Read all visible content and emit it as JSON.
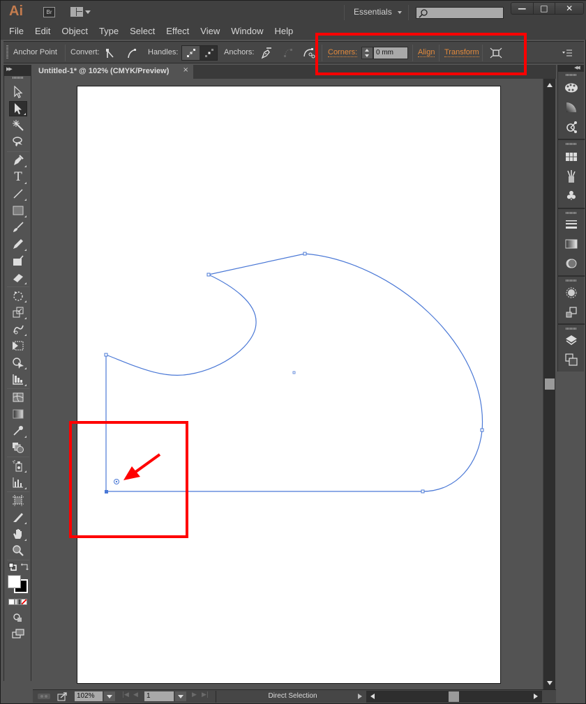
{
  "app": {
    "logo": "Ai",
    "bridge_button": "Br",
    "workspace": "Essentials",
    "search_placeholder": "",
    "window_controls": {
      "minimize": "—",
      "maximize": "□",
      "close": "✕"
    }
  },
  "menu": [
    "File",
    "Edit",
    "Object",
    "Type",
    "Select",
    "Effect",
    "View",
    "Window",
    "Help"
  ],
  "control_bar": {
    "context_label": "Anchor Point",
    "convert_label": "Convert:",
    "handles_label": "Handles:",
    "anchors_label": "Anchors:",
    "corners_label": "Corners:",
    "corners_value": "0 mm",
    "align_link": "Align",
    "transform_link": "Transform",
    "icons": {
      "convert": [
        "convert-to-corner-icon",
        "convert-to-smooth-icon"
      ],
      "handles": [
        "show-handles-icon",
        "hide-handles-icon"
      ],
      "anchors": [
        "remove-anchor-icon",
        "connect-endpoints-icon",
        "cut-path-icon"
      ],
      "isolate": "isolate-object-icon",
      "panel_menu": "panel-menu-icon"
    }
  },
  "document": {
    "tab_title": "Untitled-1* @ 102% (CMYK/Preview)",
    "tab_close": "×"
  },
  "tools": [
    "selection-tool",
    "direct-selection-tool",
    "magic-wand-tool",
    "lasso-tool",
    "pen-tool",
    "type-tool",
    "line-segment-tool",
    "rectangle-tool",
    "paintbrush-tool",
    "pencil-tool",
    "blob-brush-tool",
    "eraser-tool",
    "rotate-tool",
    "scale-tool",
    "warp-tool",
    "free-transform-tool",
    "shape-builder-tool",
    "perspective-grid-tool",
    "mesh-tool",
    "gradient-tool",
    "eyedropper-tool",
    "blend-tool",
    "symbol-sprayer-tool",
    "column-graph-tool",
    "artboard-tool",
    "slice-tool",
    "hand-tool",
    "zoom-tool"
  ],
  "active_tool": "direct-selection-tool",
  "fill_stroke": {
    "fill_color": "#ffffff",
    "stroke_color": "#000000"
  },
  "status_bar": {
    "zoom": "102%",
    "page": "1",
    "status_text": "Direct Selection"
  },
  "scroll": {
    "vertical_position_pct": 49,
    "horizontal_position_pct": 50
  },
  "right_dock": {
    "groups": [
      [
        "color-panel-icon",
        "color-guide-icon",
        "kuler-icon"
      ],
      [
        "swatches-icon",
        "brushes-icon",
        "symbols-icon"
      ],
      [
        "stroke-icon",
        "gradient-icon",
        "transparency-icon"
      ],
      [
        "appearance-icon",
        "graphic-styles-icon"
      ],
      [
        "layers-icon",
        "artboards-icon"
      ]
    ]
  },
  "path_colors": {
    "selection": "#4a78d6",
    "annotation": "#ff0000",
    "accent_link": "#e2893c"
  }
}
